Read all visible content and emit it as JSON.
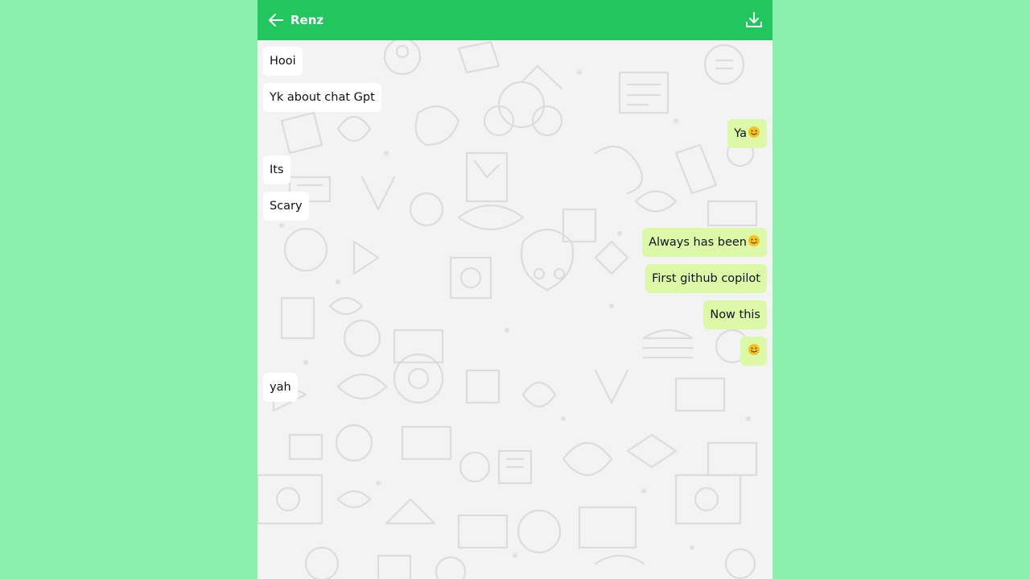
{
  "chat": {
    "contact_name": "Renz",
    "back_icon": "arrow-left-icon",
    "download_icon": "download-icon"
  },
  "colors": {
    "page_background": "#8af0ab",
    "header": "#22c65e",
    "incoming_bubble": "#ffffff",
    "outgoing_bubble": "#dcf9a8"
  },
  "messages": [
    {
      "direction": "incoming",
      "text": "Hooi"
    },
    {
      "direction": "incoming",
      "text": "Yk about chat Gpt"
    },
    {
      "direction": "outgoing",
      "text": "Ya",
      "emoji": "slightly-smiling-face"
    },
    {
      "direction": "incoming",
      "text": "Its"
    },
    {
      "direction": "incoming",
      "text": "Scary"
    },
    {
      "direction": "outgoing",
      "text": "Always has been",
      "emoji": "slightly-smiling-face"
    },
    {
      "direction": "outgoing",
      "text": "First github copilot"
    },
    {
      "direction": "outgoing",
      "text": "Now this"
    },
    {
      "direction": "outgoing",
      "text": "",
      "emoji": "slightly-smiling-face"
    },
    {
      "direction": "incoming",
      "text": "yah"
    }
  ]
}
